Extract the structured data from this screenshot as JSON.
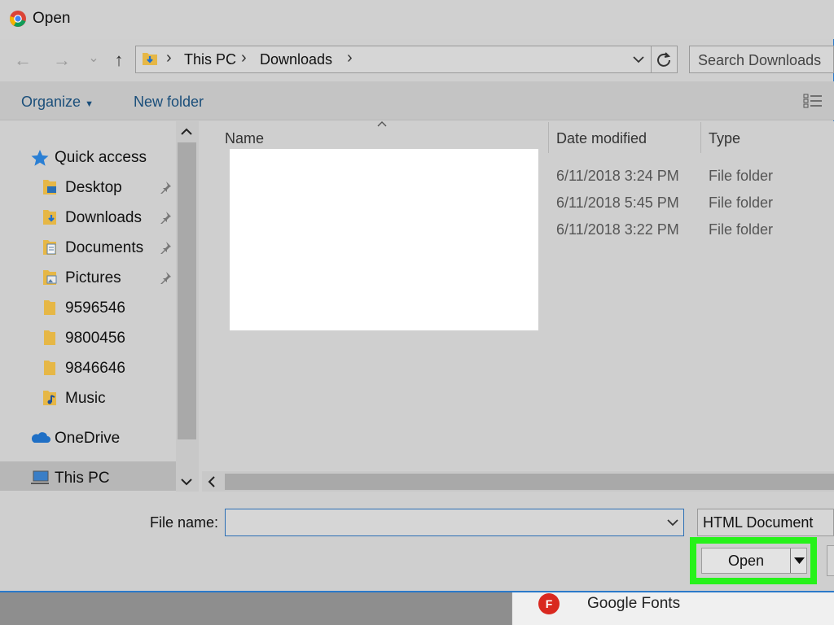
{
  "window": {
    "title": "Open"
  },
  "navigation": {
    "back_glyph": "←",
    "forward_glyph": "→",
    "recent_glyph": "⌄",
    "up_glyph": "↑"
  },
  "address_bar": {
    "breadcrumbs": [
      "This PC",
      "Downloads"
    ],
    "separator": "›"
  },
  "search": {
    "placeholder": "Search Downloads"
  },
  "toolbar": {
    "organize_label": "Organize",
    "new_folder_label": "New folder"
  },
  "nav_pane": {
    "quick_access": "Quick access",
    "items": [
      {
        "label": "Desktop",
        "pinned": true,
        "icon": "desktop-folder-icon"
      },
      {
        "label": "Downloads",
        "pinned": true,
        "icon": "downloads-folder-icon"
      },
      {
        "label": "Documents",
        "pinned": true,
        "icon": "documents-folder-icon"
      },
      {
        "label": "Pictures",
        "pinned": true,
        "icon": "pictures-folder-icon"
      },
      {
        "label": "9596546",
        "pinned": false,
        "icon": "folder-icon"
      },
      {
        "label": "9800456",
        "pinned": false,
        "icon": "folder-icon"
      },
      {
        "label": "9846646",
        "pinned": false,
        "icon": "folder-icon"
      },
      {
        "label": "Music",
        "pinned": false,
        "icon": "music-folder-icon"
      }
    ],
    "onedrive": "OneDrive",
    "this_pc": "This PC"
  },
  "file_list": {
    "columns": [
      "Name",
      "Date modified",
      "Type"
    ],
    "rows": [
      {
        "date": "6/11/2018 3:24 PM",
        "type": "File folder"
      },
      {
        "date": "6/11/2018 5:45 PM",
        "type": "File folder"
      },
      {
        "date": "6/11/2018 3:22 PM",
        "type": "File folder"
      }
    ]
  },
  "bottom": {
    "file_name_label": "File name:",
    "file_name_value": "",
    "file_type": "HTML Document",
    "open_label": "Open"
  },
  "background": {
    "tab_text": "Google Fonts",
    "tab_icon_letter": "F"
  },
  "colors": {
    "highlight": "#26f21a",
    "accent": "#2b79c9",
    "toolbar_text": "#1a4e7a"
  }
}
